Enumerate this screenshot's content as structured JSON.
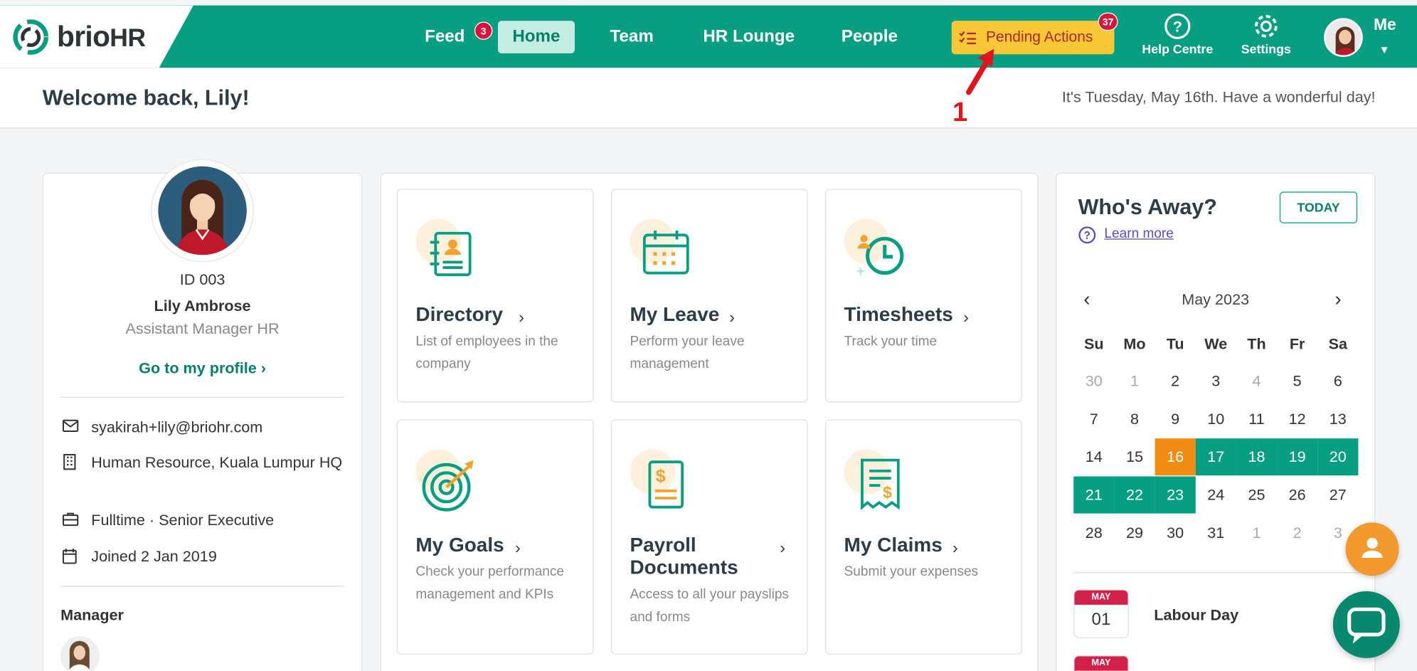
{
  "brand": {
    "name": "brio",
    "name_suffix": "HR"
  },
  "nav": {
    "feed": {
      "label": "Feed",
      "badge": "3"
    },
    "home": {
      "label": "Home"
    },
    "team": {
      "label": "Team"
    },
    "hr_lounge": {
      "label": "HR Lounge"
    },
    "people": {
      "label": "People"
    }
  },
  "pending_actions": {
    "label": "Pending Actions",
    "badge": "37"
  },
  "help": {
    "label": "Help Centre"
  },
  "settings": {
    "label": "Settings"
  },
  "me": {
    "label": "Me"
  },
  "annotation": {
    "number": "1"
  },
  "welcome": {
    "title": "Welcome back, Lily!",
    "date_message": "It's Tuesday, May 16th. Have a wonderful day!"
  },
  "profile": {
    "id": "ID 003",
    "name": "Lily Ambrose",
    "role": "Assistant Manager HR",
    "link": "Go to my profile",
    "email": "syakirah+lily@briohr.com",
    "department": "Human Resource, Kuala Lumpur HQ",
    "employment": "Fulltime · Senior Executive",
    "joined": "Joined 2 Jan 2019",
    "manager_label": "Manager"
  },
  "tiles": [
    {
      "title": "Directory",
      "desc": "List of employees in the company"
    },
    {
      "title": "My Leave",
      "desc": "Perform your leave management"
    },
    {
      "title": "Timesheets",
      "desc": "Track your time"
    },
    {
      "title": "My Goals",
      "desc": "Check your performance management and KPIs"
    },
    {
      "title": "Payroll Documents",
      "desc": "Access to all your payslips and forms"
    },
    {
      "title": "My Claims",
      "desc": "Submit your expenses"
    }
  ],
  "away": {
    "title": "Who's Away?",
    "today_button": "TODAY",
    "learn_more": "Learn more",
    "month": "May 2023",
    "weekdays": [
      "Su",
      "Mo",
      "Tu",
      "We",
      "Th",
      "Fr",
      "Sa"
    ],
    "weeks": [
      [
        "30",
        "1",
        "2",
        "3",
        "4",
        "5",
        "6"
      ],
      [
        "7",
        "8",
        "9",
        "10",
        "11",
        "12",
        "13"
      ],
      [
        "14",
        "15",
        "16",
        "17",
        "18",
        "19",
        "20"
      ],
      [
        "21",
        "22",
        "23",
        "24",
        "25",
        "26",
        "27"
      ],
      [
        "28",
        "29",
        "30",
        "31",
        "1",
        "2",
        "3"
      ]
    ],
    "muted_days": [
      "0-0",
      "0-1",
      "0-4",
      "4-4",
      "4-5",
      "4-6"
    ],
    "today_day": "2-2",
    "highlighted_days": [
      "2-3",
      "2-4",
      "2-5",
      "2-6",
      "3-0",
      "3-1",
      "3-2"
    ],
    "holidays": [
      {
        "month": "MAY",
        "day": "01",
        "name": "Labour Day"
      },
      {
        "month": "MAY",
        "day": "",
        "name": ""
      }
    ]
  },
  "colors": {
    "brand_green": "#079e82",
    "pending_yellow": "#f9c837",
    "alert_red": "#d9143c",
    "today_orange": "#f08c14"
  }
}
